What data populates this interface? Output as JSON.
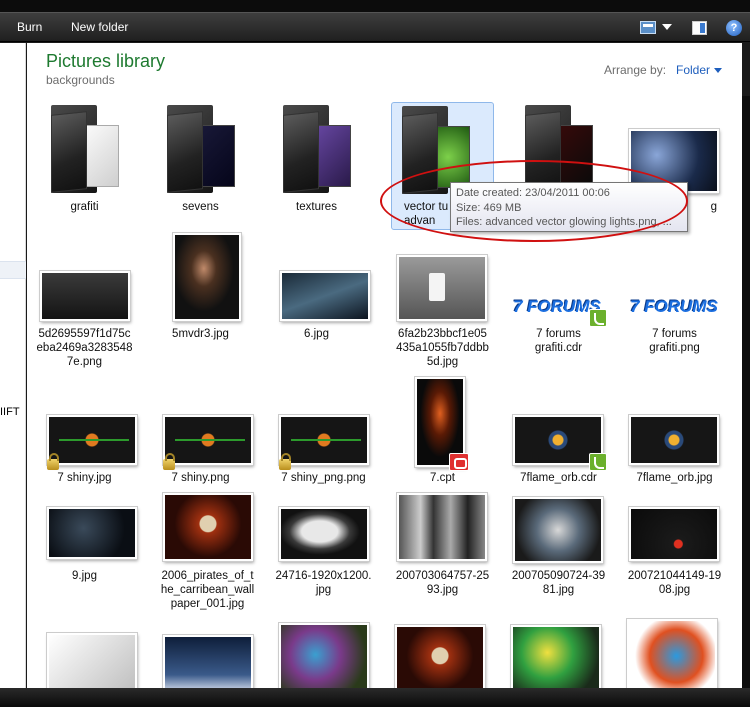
{
  "toolbar": {
    "burn_label": "Burn",
    "new_folder_label": "New folder",
    "help_label": "?"
  },
  "navpane": {
    "partial_text": "IIFT"
  },
  "header": {
    "title": "Pictures library",
    "subtitle": "backgrounds",
    "arrange_label": "Arrange by:",
    "arrange_value": "Folder"
  },
  "items": [
    {
      "caption": "grafiti",
      "kind": "folder"
    },
    {
      "caption": "sevens",
      "kind": "folder"
    },
    {
      "caption": "textures",
      "kind": "folder"
    },
    {
      "caption": "vector tu\nadvan",
      "kind": "folder",
      "selected": true
    },
    {
      "caption": "",
      "kind": "folder"
    },
    {
      "caption": "g",
      "kind": "image"
    },
    {
      "caption": "5d2695597f1d75c\neba2469a3283548\n7e.png",
      "kind": "image"
    },
    {
      "caption": "5mvdr3.jpg",
      "kind": "image"
    },
    {
      "caption": "6.jpg",
      "kind": "image"
    },
    {
      "caption": "6fa2b23bbcf1e05\n435a1055fb7ddbb\n5d.jpg",
      "kind": "image"
    },
    {
      "caption": "7 forums\ngrafiti.cdr",
      "kind": "image"
    },
    {
      "caption": "7 forums\ngrafiti.png",
      "kind": "image"
    },
    {
      "caption": "7 shiny.jpg",
      "kind": "image"
    },
    {
      "caption": "7 shiny.png",
      "kind": "image"
    },
    {
      "caption": "7 shiny_png.png",
      "kind": "image"
    },
    {
      "caption": "7.cpt",
      "kind": "image"
    },
    {
      "caption": "7flame_orb.cdr",
      "kind": "image"
    },
    {
      "caption": "7flame_orb.jpg",
      "kind": "image"
    },
    {
      "caption": "9.jpg",
      "kind": "image"
    },
    {
      "caption": "2006_pirates_of_t\nhe_carribean_wall\npaper_001.jpg",
      "kind": "image"
    },
    {
      "caption": "24716-1920x1200.\njpg",
      "kind": "image"
    },
    {
      "caption": "200703064757-25\n93.jpg",
      "kind": "image"
    },
    {
      "caption": "200705090724-39\n81.jpg",
      "kind": "image"
    },
    {
      "caption": "200721044149-19\n08.jpg",
      "kind": "image"
    }
  ],
  "thumbs": {
    "forums_text": "7 FORUMS"
  },
  "tooltip": {
    "date_created": "Date created: 23/04/2011 00:06",
    "size": "Size: 469 MB",
    "files": "Files: advanced vector glowing lights.png, ..."
  },
  "colors": {
    "title_green": "#1e7a30",
    "link_blue": "#1e5ebd",
    "annotation_red": "#d01010",
    "selection_bg": "#dbeafd"
  }
}
